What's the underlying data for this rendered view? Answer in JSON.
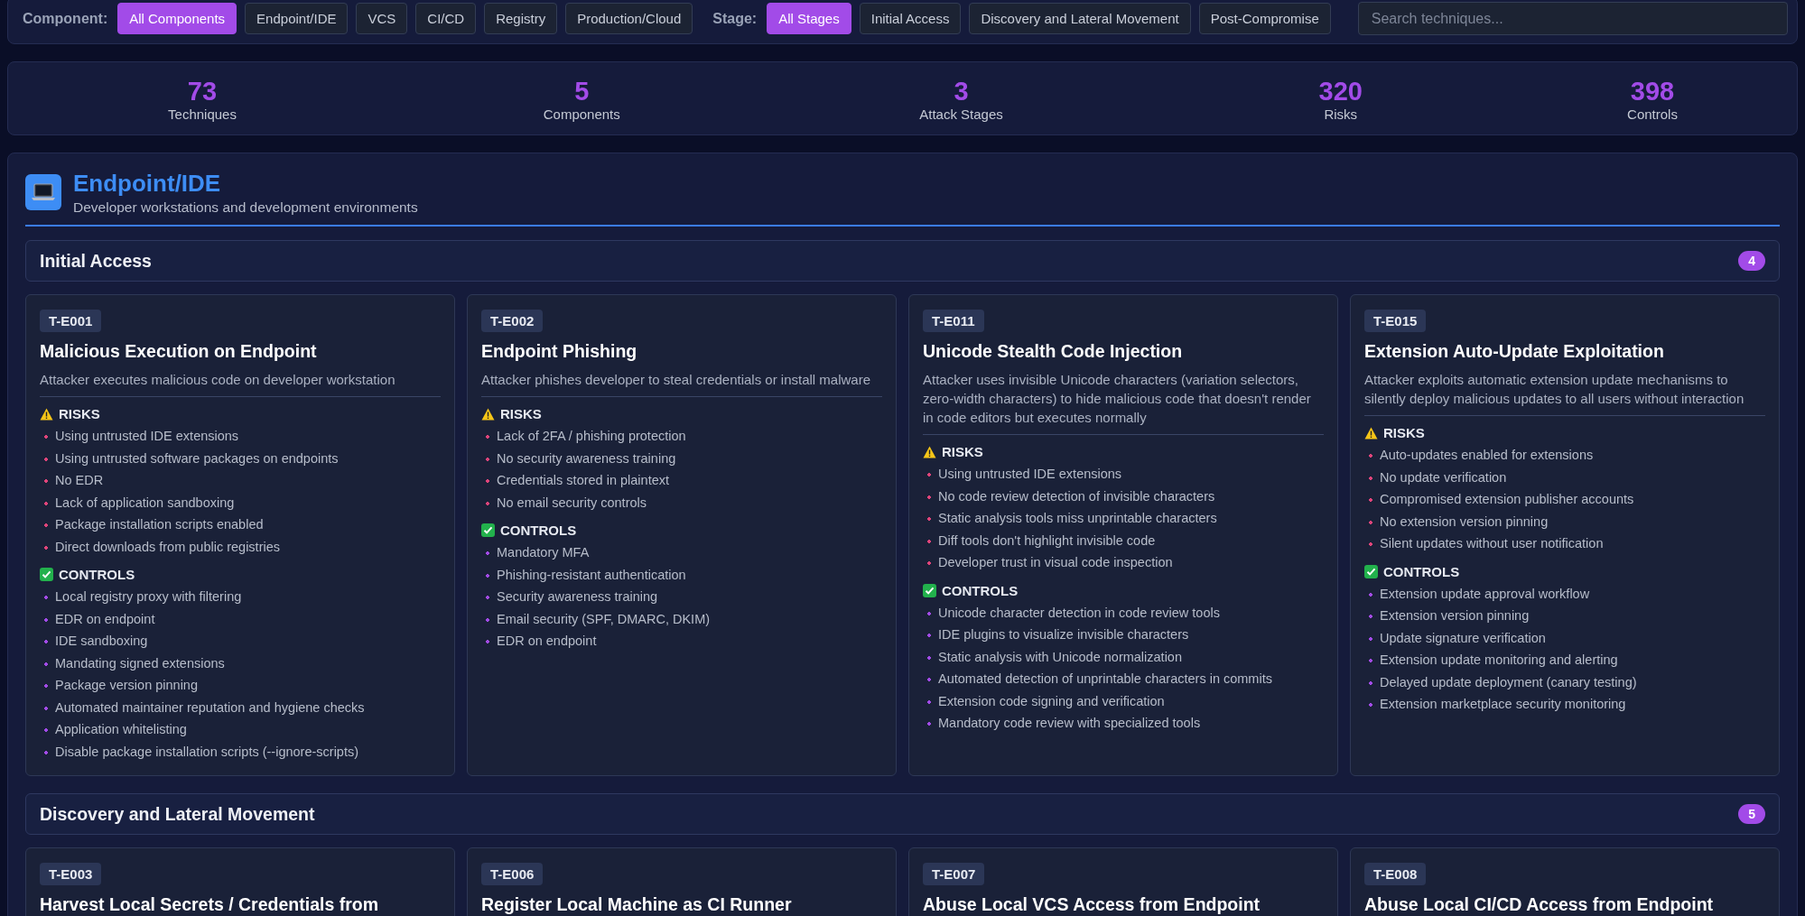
{
  "filters": [
    {
      "label": "Component:",
      "options": [
        {
          "label": "All Components",
          "selected": true
        },
        {
          "label": "Endpoint/IDE",
          "selected": false
        },
        {
          "label": "VCS",
          "selected": false
        },
        {
          "label": "CI/CD",
          "selected": false
        },
        {
          "label": "Registry",
          "selected": false
        },
        {
          "label": "Production/Cloud",
          "selected": false
        }
      ]
    },
    {
      "label": "Stage:",
      "options": [
        {
          "label": "All Stages",
          "selected": true
        },
        {
          "label": "Initial Access",
          "selected": false
        },
        {
          "label": "Discovery and Lateral Movement",
          "selected": false
        },
        {
          "label": "Post-Compromise",
          "selected": false
        }
      ]
    }
  ],
  "search": {
    "placeholder": "Search techniques..."
  },
  "stats": [
    {
      "value": "73",
      "label": "Techniques"
    },
    {
      "value": "5",
      "label": "Components"
    },
    {
      "value": "3",
      "label": "Attack Stages"
    },
    {
      "value": "320",
      "label": "Risks"
    },
    {
      "value": "398",
      "label": "Controls"
    }
  ],
  "section": {
    "title": "Endpoint/IDE",
    "description": "Developer workstations and development environments",
    "stages": [
      {
        "title": "Initial Access",
        "count": "4",
        "techniques": [
          {
            "id": "T-E001",
            "title": "Malicious Execution on Endpoint",
            "description": "Attacker executes malicious code on developer workstation",
            "risks": {
              "heading": "RISKS",
              "items": [
                "Using untrusted IDE extensions",
                "Using untrusted software packages on endpoints",
                "No EDR",
                "Lack of application sandboxing",
                "Package installation scripts enabled",
                "Direct downloads from public registries"
              ]
            },
            "controls": {
              "heading": "CONTROLS",
              "items": [
                "Local registry proxy with filtering",
                "EDR on endpoint",
                "IDE sandboxing",
                "Mandating signed extensions",
                "Package version pinning",
                "Automated maintainer reputation and hygiene checks",
                "Application whitelisting",
                "Disable package installation scripts (--ignore-scripts)"
              ]
            }
          },
          {
            "id": "T-E002",
            "title": "Endpoint Phishing",
            "description": "Attacker phishes developer to steal credentials or install malware",
            "risks": {
              "heading": "RISKS",
              "items": [
                "Lack of 2FA / phishing protection",
                "No security awareness training",
                "Credentials stored in plaintext",
                "No email security controls"
              ]
            },
            "controls": {
              "heading": "CONTROLS",
              "items": [
                "Mandatory MFA",
                "Phishing-resistant authentication",
                "Security awareness training",
                "Email security (SPF, DMARC, DKIM)",
                "EDR on endpoint"
              ]
            }
          },
          {
            "id": "T-E011",
            "title": "Unicode Stealth Code Injection",
            "description": "Attacker uses invisible Unicode characters (variation selectors, zero-width characters) to hide malicious code that doesn't render in code editors but executes normally",
            "risks": {
              "heading": "RISKS",
              "items": [
                "Using untrusted IDE extensions",
                "No code review detection of invisible characters",
                "Static analysis tools miss unprintable characters",
                "Diff tools don't highlight invisible code",
                "Developer trust in visual code inspection"
              ]
            },
            "controls": {
              "heading": "CONTROLS",
              "items": [
                "Unicode character detection in code review tools",
                "IDE plugins to visualize invisible characters",
                "Static analysis with Unicode normalization",
                "Automated detection of unprintable characters in commits",
                "Extension code signing and verification",
                "Mandatory code review with specialized tools"
              ]
            }
          },
          {
            "id": "T-E015",
            "title": "Extension Auto-Update Exploitation",
            "description": "Attacker exploits automatic extension update mechanisms to silently deploy malicious updates to all users without interaction",
            "risks": {
              "heading": "RISKS",
              "items": [
                "Auto-updates enabled for extensions",
                "No update verification",
                "Compromised extension publisher accounts",
                "No extension version pinning",
                "Silent updates without user notification"
              ]
            },
            "controls": {
              "heading": "CONTROLS",
              "items": [
                "Extension update approval workflow",
                "Extension version pinning",
                "Update signature verification",
                "Extension update monitoring and alerting",
                "Delayed update deployment (canary testing)",
                "Extension marketplace security monitoring"
              ]
            }
          }
        ]
      },
      {
        "title": "Discovery and Lateral Movement",
        "count": "5",
        "techniques": [
          {
            "id": "T-E003",
            "title": "Harvest Local Secrets / Credentials from"
          },
          {
            "id": "T-E006",
            "title": "Register Local Machine as CI Runner"
          },
          {
            "id": "T-E007",
            "title": "Abuse Local VCS Access from Endpoint"
          },
          {
            "id": "T-E008",
            "title": "Abuse Local CI/CD Access from Endpoint"
          }
        ]
      }
    ]
  }
}
